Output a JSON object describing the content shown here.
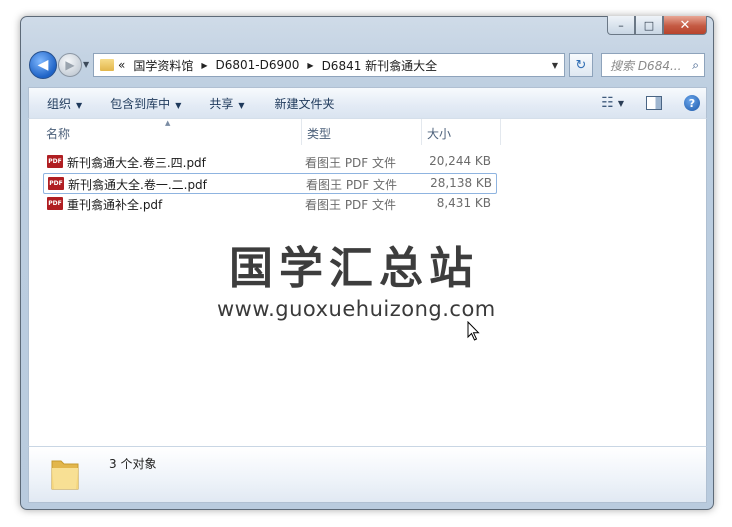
{
  "window": {
    "min_label": "–",
    "max_label": "□",
    "close_label": "✕"
  },
  "nav": {
    "back_glyph": "◀",
    "forward_glyph": "▶",
    "history_glyph": "▼",
    "overflow": "«",
    "breadcrumbs": [
      "国学资料馆",
      "D6801-D6900",
      "D6841 新刊翕通大全"
    ],
    "refresh_glyph": "↻",
    "search_placeholder": "搜索 D684...",
    "search_glyph": "⌕"
  },
  "toolbar": {
    "organize": "组织",
    "include_in_library": "包含到库中",
    "share": "共享",
    "new_folder": "新建文件夹",
    "views_glyph": "☷",
    "help_glyph": "?"
  },
  "columns": {
    "name": "名称",
    "type": "类型",
    "size": "大小"
  },
  "files": [
    {
      "name": "新刊翕通大全.卷三.四.pdf",
      "type": "看图王 PDF 文件",
      "size": "20,244 KB",
      "icon_label": "PDF"
    },
    {
      "name": "新刊翕通大全.卷一.二.pdf",
      "type": "看图王 PDF 文件",
      "size": "28,138 KB",
      "icon_label": "PDF"
    },
    {
      "name": "重刊翕通补全.pdf",
      "type": "看图王 PDF 文件",
      "size": "8,431 KB",
      "icon_label": "PDF"
    }
  ],
  "watermark": {
    "title": "国学汇总站",
    "url": "www.guoxuehuizong.com"
  },
  "status": {
    "item_count": "3 个对象"
  },
  "colors": {
    "accent": "#1f63c6",
    "pdf_icon": "#b01e22",
    "selection_border": "#8fb4e0"
  }
}
